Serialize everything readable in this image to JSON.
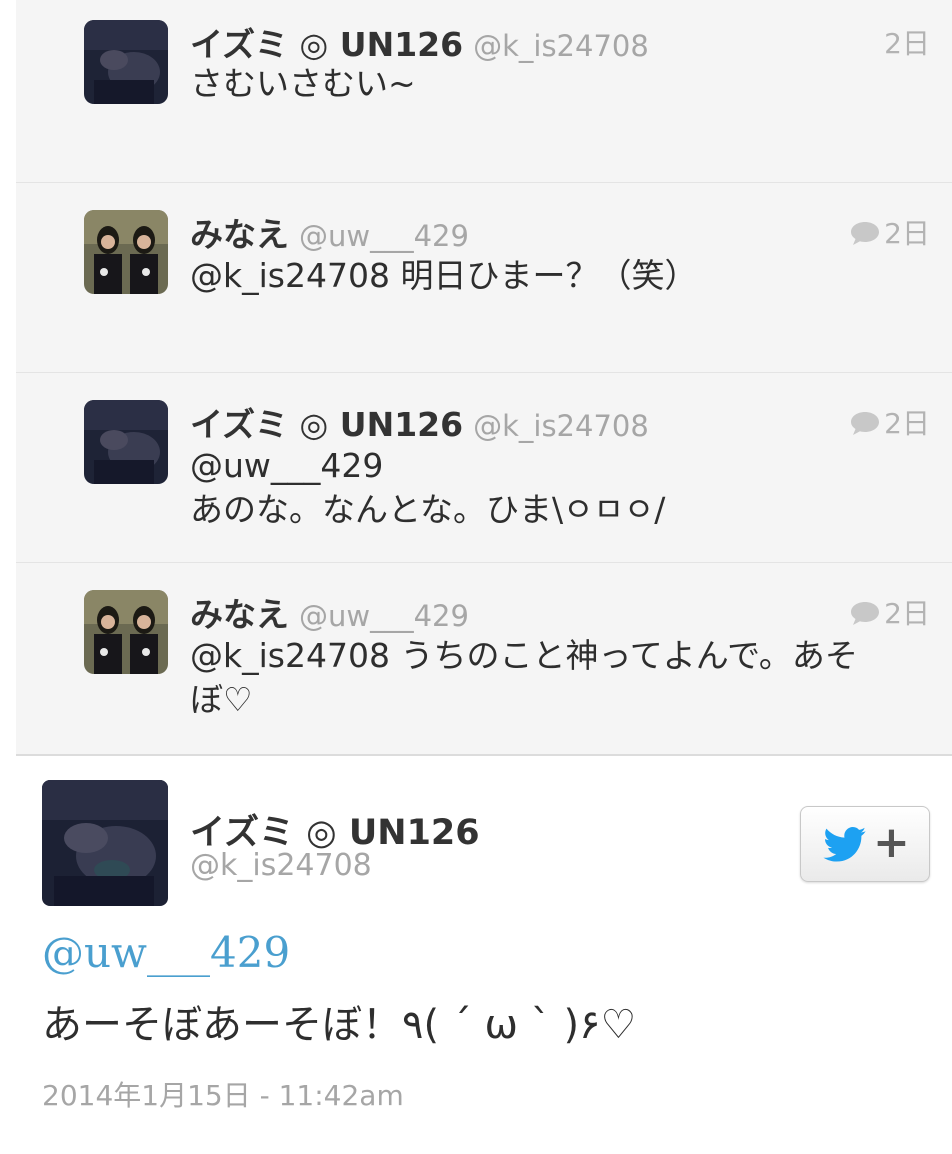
{
  "tweets": [
    {
      "name": "イズミ ◎ UN126",
      "handle": "@k_is24708",
      "time": "2日",
      "reply": false,
      "lines": [
        "さむいさむい~"
      ]
    },
    {
      "name": "みなえ",
      "handle": "@uw___429",
      "time": "2日",
      "reply": true,
      "lines": [
        "@k_is24708 明日ひまー？（笑）"
      ]
    },
    {
      "name": "イズミ ◎ UN126",
      "handle": "@k_is24708",
      "time": "2日",
      "reply": true,
      "lines": [
        "@uw___429",
        "あのな。なんとな。ひま\\ㅇㅁㅇ/"
      ]
    },
    {
      "name": "みなえ",
      "handle": "@uw___429",
      "time": "2日",
      "reply": true,
      "lines": [
        "@k_is24708 うちのこと神ってよんで。あそ",
        "ぼ♡"
      ]
    }
  ],
  "main_tweet": {
    "name": "イズミ ◎ UN126",
    "handle": "@k_is24708",
    "mention": "@uw___429",
    "text": "あーそぼあーそぼ！٩( ´ ω ` )۶♡",
    "date": "2014年1月15日 - 11:42am",
    "follow_plus": "+"
  },
  "colors": {
    "mention_blue": "#4a9fcf",
    "twitter_blue": "#1da1f2",
    "conversation_bg": "#f5f5f5"
  },
  "icons": {
    "reply": "speech-bubble-icon",
    "follow": "twitter-bird-icon"
  }
}
